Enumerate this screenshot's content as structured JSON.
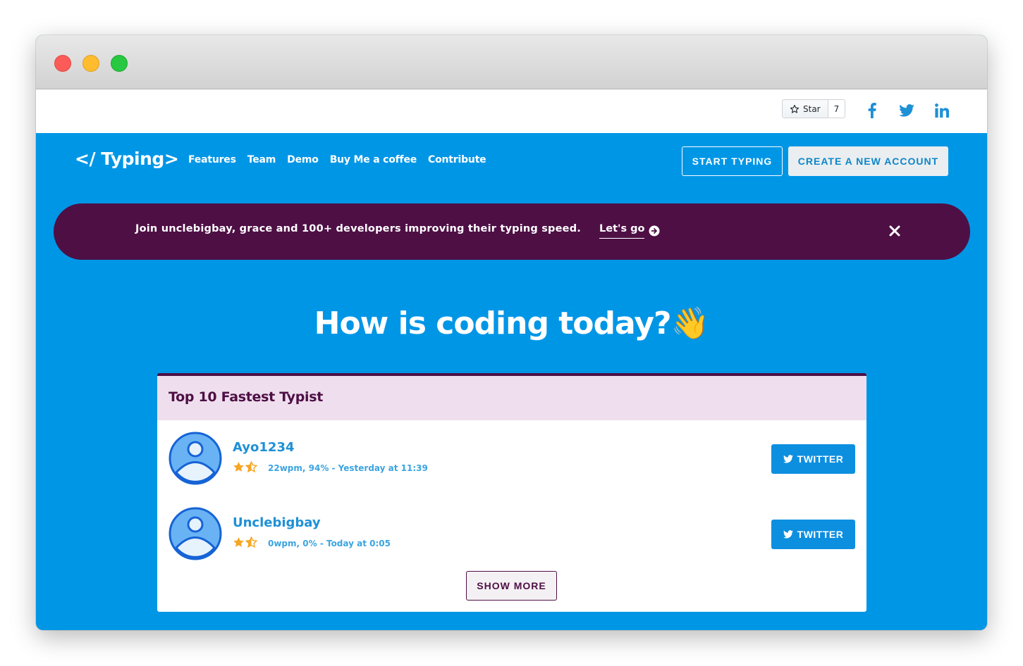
{
  "colors": {
    "brand_blue": "#0096e6",
    "banner_purple": "#4e0f45",
    "card_header_bg": "#efdfee",
    "twitter_blue": "#0d8fe0",
    "star_orange": "#f5a623"
  },
  "github": {
    "star_label": "Star",
    "star_count": "7"
  },
  "social_icons": [
    "facebook-icon",
    "twitter-icon",
    "linkedin-icon"
  ],
  "nav": {
    "logo": "</ Typing>",
    "links": [
      "Features",
      "Team",
      "Demo",
      "Buy Me a coffee",
      "Contribute"
    ],
    "start_typing": "START TYPING",
    "create_account": "CREATE A NEW ACCOUNT"
  },
  "banner": {
    "text": "Join unclebigbay, grace and 100+ developers improving their typing speed.",
    "cta": "Let's go",
    "close_icon": "close-icon"
  },
  "hero": {
    "title": "How is coding today?",
    "emoji": "👋"
  },
  "leaderboard": {
    "title": "Top 10 Fastest Typist",
    "entries": [
      {
        "name": "Ayo1234",
        "rating": 1.5,
        "meta": "22wpm, 94% - Yesterday at 11:39",
        "button": "TWITTER"
      },
      {
        "name": "Unclebigbay",
        "rating": 1.5,
        "meta": "0wpm, 0% - Today at 0:05",
        "button": "TWITTER"
      }
    ],
    "show_more": "SHOW MORE"
  }
}
